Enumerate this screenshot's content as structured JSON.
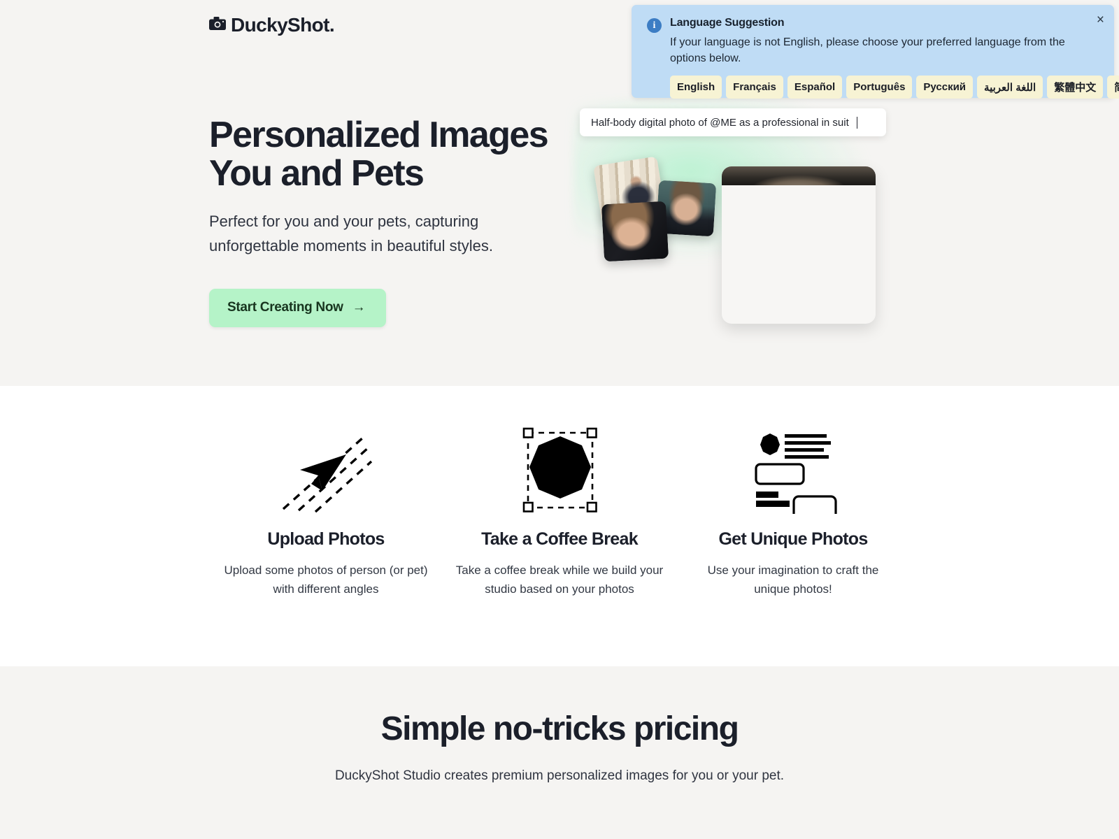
{
  "brand": {
    "name": "DuckyShot.",
    "logo_icon": "camera-icon"
  },
  "hero": {
    "title_line1": "Personalized Images",
    "title_line2": "You and Pets",
    "subtitle": "Perfect for you and your pets, capturing unforgettable moments in beautiful styles.",
    "cta_label": "Start Creating Now",
    "cta_arrow": "→",
    "cta_bg": "#b5f3c8",
    "prompt_value": "Half-body digital photo of @ME as a professional in suit",
    "background": "#f5f4f2"
  },
  "features": [
    {
      "icon": "upload-paper-plane-icon",
      "title": "Upload Photos",
      "desc": "Upload some photos of person (or pet) with different angles"
    },
    {
      "icon": "selection-octagon-icon",
      "title": "Take a Coffee Break",
      "desc": "Take a coffee break while we build your studio based on your photos"
    },
    {
      "icon": "layout-blocks-icon",
      "title": "Get Unique Photos",
      "desc": "Use your imagination to craft the unique photos!"
    }
  ],
  "pricing": {
    "title": "Simple no-tricks pricing",
    "subtitle": "DuckyShot Studio creates premium personalized images for you or your pet.",
    "background": "#f5f4f2"
  },
  "language_banner": {
    "icon": "info-icon",
    "title": "Language Suggestion",
    "description": "If your language is not English, please choose your preferred language from the options below.",
    "close_label": "×",
    "background": "#bfdcf5",
    "chip_background": "#f7f3d4",
    "options": [
      "English",
      "Français",
      "Español",
      "Português",
      "Русский",
      "اللغة العربية",
      "繁體中文",
      "简体中文"
    ]
  }
}
